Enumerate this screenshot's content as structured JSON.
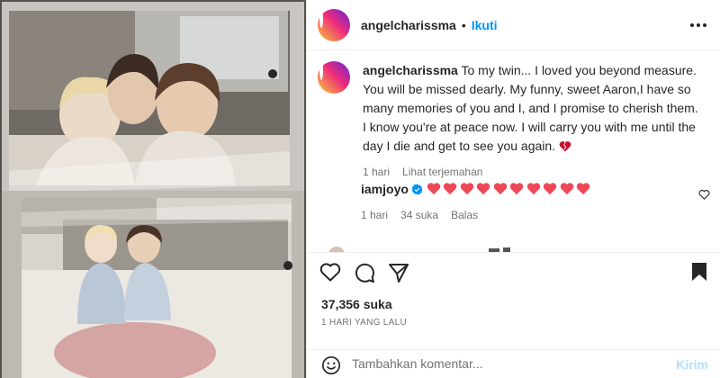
{
  "post": {
    "photo_description": "image",
    "author": "angelcharissma",
    "follow_label": "Ikuti",
    "separator": "•",
    "caption": {
      "username": "angelcharissma",
      "text": "To my twin... I loved you beyond measure. You will be missed dearly. My funny, sweet Aaron,I have so many memories of you and I, and I promise to cherish them. I know you're at peace now. I will carry you with me until the day I die and get to see you again.",
      "time": "1 hari",
      "translate_label": "Lihat terjemahan"
    },
    "comments": [
      {
        "username": "iamjoyo",
        "hearts": 10,
        "time": "1 hari",
        "likes": "34 suka",
        "reply_label": "Balas"
      }
    ],
    "likes_label": "37,356 suka",
    "timestamp": "1 HARI YANG LALU",
    "composer": {
      "placeholder": "Tambahkan komentar...",
      "send_label": "Kirim"
    }
  },
  "colors": {
    "link_blue": "#0095f6",
    "heart_red": "#ed4956",
    "muted": "#737373",
    "send_disabled": "#b2dffc"
  },
  "icons": [
    "more-icon",
    "heart-icon",
    "comment-icon",
    "share-icon",
    "bookmark-icon",
    "emoji-icon",
    "verified-icon"
  ]
}
